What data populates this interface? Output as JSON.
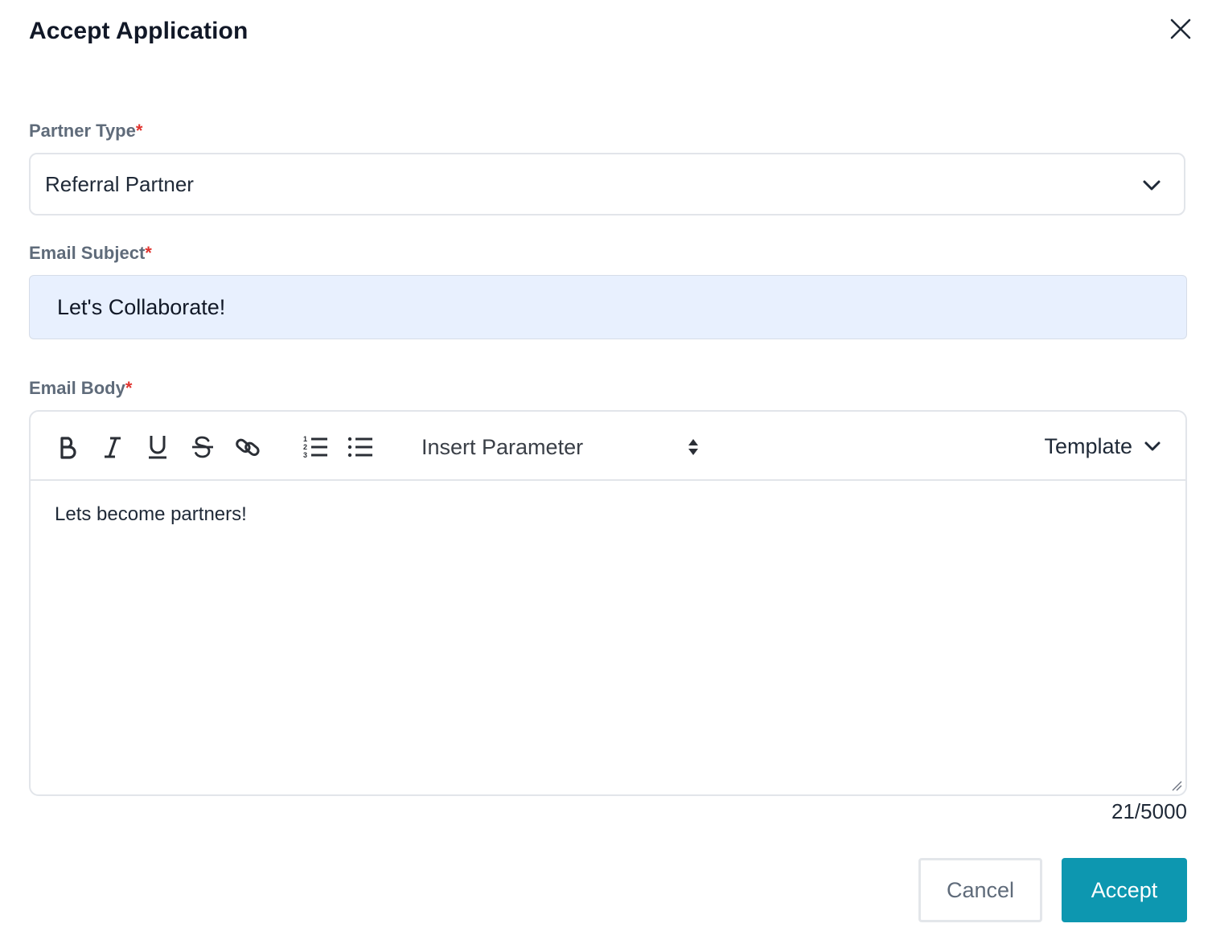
{
  "dialog": {
    "title": "Accept Application",
    "close_icon": "close-icon"
  },
  "form": {
    "partner_type": {
      "label": "Partner Type",
      "required_mark": "*",
      "value": "Referral Partner",
      "icon": "chevron-down-icon"
    },
    "email_subject": {
      "label": "Email Subject",
      "required_mark": "*",
      "value": "Let's Collaborate!"
    },
    "email_body": {
      "label": "Email Body",
      "required_mark": "*",
      "toolbar": {
        "buttons": [
          "bold-icon",
          "italic-icon",
          "underline-icon",
          "strikethrough-icon",
          "link-icon",
          "ordered-list-icon",
          "bullet-list-icon"
        ],
        "insert_parameter_label": "Insert Parameter",
        "template_label": "Template"
      },
      "content": "Lets become partners!",
      "char_count": "21/5000"
    }
  },
  "actions": {
    "cancel_label": "Cancel",
    "accept_label": "Accept"
  },
  "colors": {
    "accent": "#0d97b0",
    "required": "#e0342f",
    "label": "#5f6b7a",
    "input_autofill_bg": "#e8f0fe",
    "border": "#e2e5ea"
  }
}
